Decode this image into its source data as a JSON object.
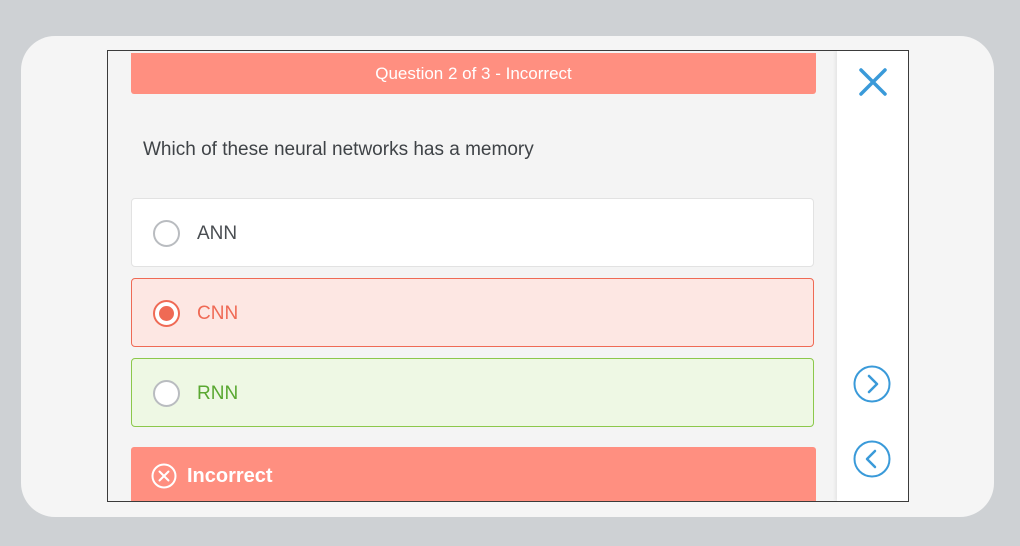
{
  "quiz": {
    "header": "Question 2 of 3 - Incorrect",
    "question": "Which of these neural networks has a memory",
    "options": [
      {
        "label": "ANN",
        "state": "unselected"
      },
      {
        "label": "CNN",
        "state": "selected-incorrect"
      },
      {
        "label": "RNN",
        "state": "correct-answer"
      }
    ],
    "result": {
      "label": "Incorrect",
      "icon": "circle-x-icon"
    }
  },
  "side_panel": {
    "close_icon": "close-icon",
    "next_icon": "chevron-right-circle-icon",
    "prev_icon": "chevron-left-circle-icon"
  },
  "colors": {
    "accent": "#3a9ad9",
    "incorrect": "#ff8f80",
    "incorrect_border": "#ef6a55",
    "correct_border": "#8cc84b",
    "correct_text": "#5aa832"
  }
}
